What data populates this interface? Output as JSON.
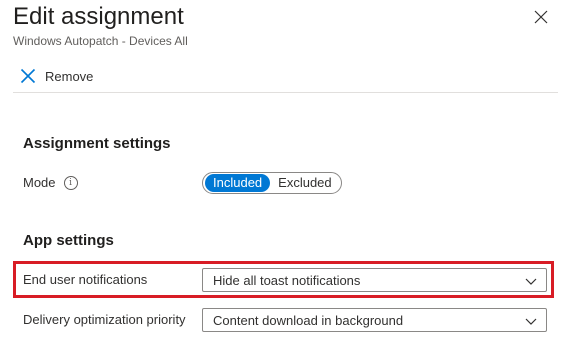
{
  "header": {
    "title": "Edit assignment",
    "subtitle": "Windows Autopatch - Devices All"
  },
  "toolbar": {
    "remove_label": "Remove"
  },
  "assignment_settings": {
    "heading": "Assignment settings",
    "mode_label": "Mode",
    "mode_options": [
      "Included",
      "Excluded"
    ],
    "mode_selected": "Included"
  },
  "app_settings": {
    "heading": "App settings",
    "end_user_notifications": {
      "label": "End user notifications",
      "value": "Hide all toast notifications"
    },
    "delivery_optimization": {
      "label": "Delivery optimization priority",
      "value": "Content download in background"
    }
  },
  "colors": {
    "accent": "#0078d4",
    "highlight": "#d81c25"
  },
  "icons": {
    "close": "close-icon",
    "remove": "x-icon",
    "info": "info-icon",
    "chevron": "chevron-down-icon"
  }
}
